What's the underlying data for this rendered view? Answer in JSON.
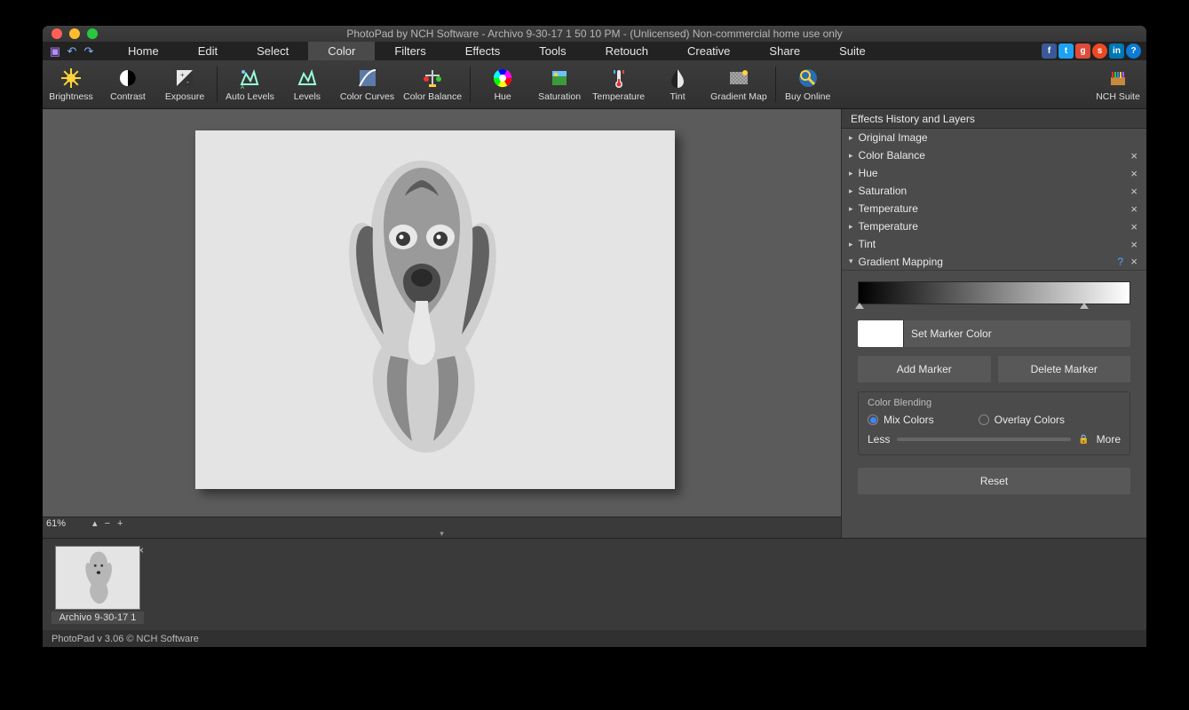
{
  "title": "PhotoPad by NCH Software - Archivo 9-30-17 1 50 10 PM - (Unlicensed) Non-commercial home use only",
  "menu": [
    "Home",
    "Edit",
    "Select",
    "Color",
    "Filters",
    "Effects",
    "Tools",
    "Retouch",
    "Creative",
    "Share",
    "Suite"
  ],
  "menu_active": 3,
  "toolbar": [
    {
      "label": "Brightness",
      "icon": "brightness"
    },
    {
      "label": "Contrast",
      "icon": "contrast"
    },
    {
      "label": "Exposure",
      "icon": "exposure"
    },
    {
      "sep": true
    },
    {
      "label": "Auto Levels",
      "icon": "autolevels"
    },
    {
      "label": "Levels",
      "icon": "levels"
    },
    {
      "label": "Color Curves",
      "icon": "curves"
    },
    {
      "label": "Color Balance",
      "icon": "balance"
    },
    {
      "sep": true
    },
    {
      "label": "Hue",
      "icon": "hue"
    },
    {
      "label": "Saturation",
      "icon": "saturation"
    },
    {
      "label": "Temperature",
      "icon": "temperature"
    },
    {
      "label": "Tint",
      "icon": "tint"
    },
    {
      "label": "Gradient Map",
      "icon": "gradientmap"
    },
    {
      "sep": true
    },
    {
      "label": "Buy Online",
      "icon": "buy"
    },
    {
      "spacer": true
    },
    {
      "label": "NCH Suite",
      "icon": "suite"
    }
  ],
  "zoom": "61%",
  "side_title": "Effects History and Layers",
  "layers": [
    {
      "label": "Original Image",
      "closeable": false
    },
    {
      "label": "Color Balance",
      "closeable": true
    },
    {
      "label": "Hue",
      "closeable": true
    },
    {
      "label": "Saturation",
      "closeable": true
    },
    {
      "label": "Temperature",
      "closeable": true
    },
    {
      "label": "Temperature",
      "closeable": true
    },
    {
      "label": "Tint",
      "closeable": true
    }
  ],
  "expanded_layer": "Gradient Mapping",
  "marker_label": "Set Marker Color",
  "add_marker": "Add Marker",
  "del_marker": "Delete Marker",
  "blend_title": "Color Blending",
  "blend_mix": "Mix Colors",
  "blend_overlay": "Overlay Colors",
  "less": "Less",
  "more": "More",
  "reset": "Reset",
  "thumb_label": "Archivo 9-30-17 1",
  "status": "PhotoPad v 3.06 © NCH Software"
}
